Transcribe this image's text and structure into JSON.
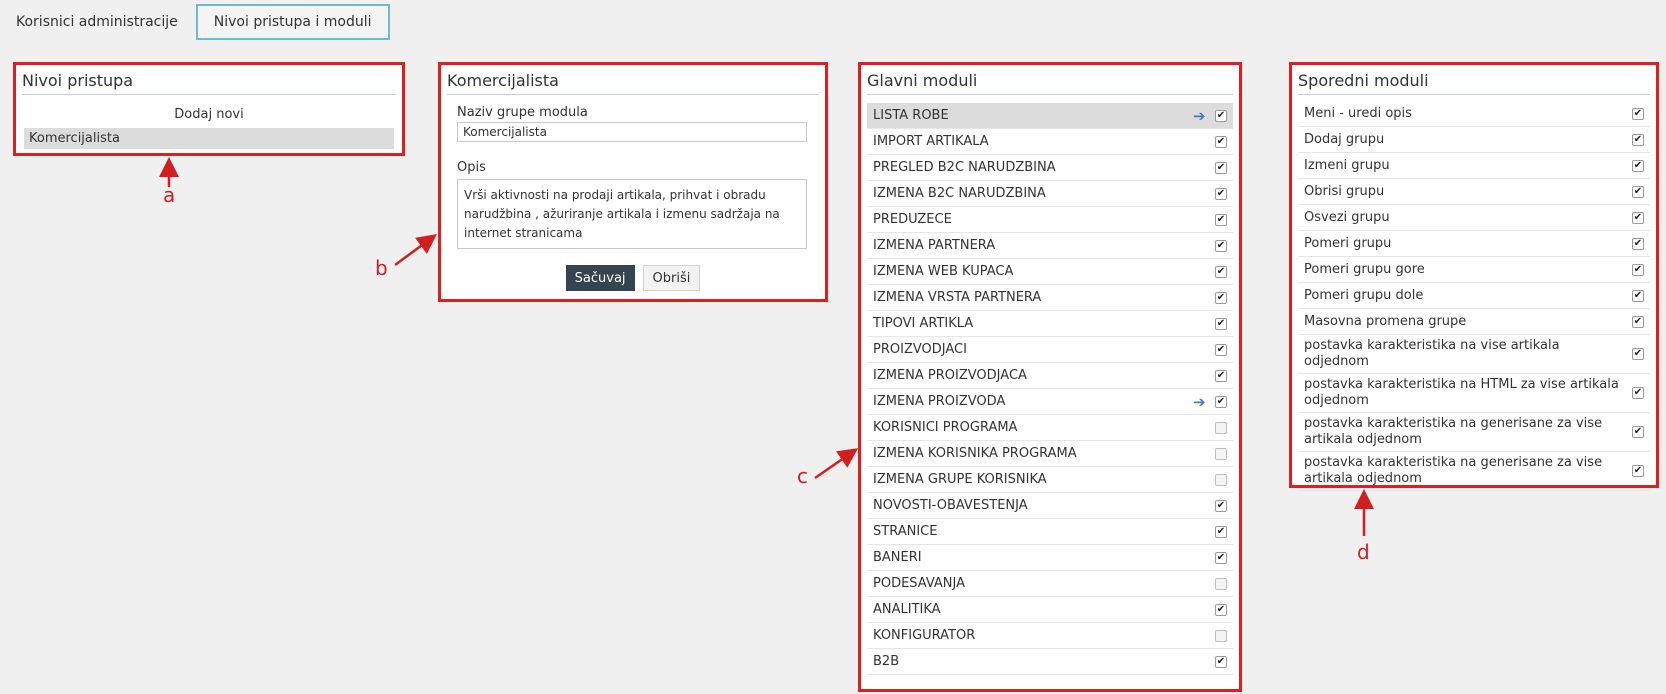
{
  "tabs": [
    {
      "label": "Korisnici administracije",
      "active": false
    },
    {
      "label": "Nivoi pristupa i moduli",
      "active": true
    }
  ],
  "access_levels": {
    "title": "Nivoi pristupa",
    "add_new": "Dodaj novi",
    "items": [
      "Komercijalista"
    ]
  },
  "group_editor": {
    "title": "Komercijalista",
    "name_label": "Naziv grupe modula",
    "name_value": "Komercijalista",
    "description_label": "Opis",
    "description_value": "Vrši aktivnosti na prodaji artikala, prihvat i obradu narudžbina , ažuriranje artikala i izmenu sadržaja na internet stranicama",
    "save_label": "Sačuvaj",
    "delete_label": "Obriši"
  },
  "main_modules": {
    "title": "Glavni moduli",
    "items": [
      {
        "label": "LISTA ROBE",
        "checked": true,
        "arrow": true,
        "highlight": true
      },
      {
        "label": "IMPORT ARTIKALA",
        "checked": true
      },
      {
        "label": "PREGLED B2C NARUDZBINA",
        "checked": true
      },
      {
        "label": "IZMENA B2C NARUDZBINA",
        "checked": true
      },
      {
        "label": "PREDUZECE",
        "checked": true
      },
      {
        "label": "IZMENA PARTNERA",
        "checked": true
      },
      {
        "label": "IZMENA WEB KUPACA",
        "checked": true
      },
      {
        "label": "IZMENA VRSTA PARTNERA",
        "checked": true
      },
      {
        "label": "TIPOVI ARTIKLA",
        "checked": true
      },
      {
        "label": "PROIZVODJACI",
        "checked": true
      },
      {
        "label": "IZMENA PROIZVODJACA",
        "checked": true
      },
      {
        "label": "IZMENA PROIZVODA",
        "checked": true,
        "arrow": true
      },
      {
        "label": "KORISNICI PROGRAMA",
        "checked": false
      },
      {
        "label": "IZMENA KORISNIKA PROGRAMA",
        "checked": false
      },
      {
        "label": "IZMENA GRUPE KORISNIKA",
        "checked": false
      },
      {
        "label": "NOVOSTI-OBAVESTENJA",
        "checked": true
      },
      {
        "label": "STRANICE",
        "checked": true
      },
      {
        "label": "BANERI",
        "checked": true
      },
      {
        "label": "PODESAVANJA",
        "checked": false
      },
      {
        "label": "ANALITIKA",
        "checked": true
      },
      {
        "label": "KONFIGURATOR",
        "checked": false
      },
      {
        "label": "B2B",
        "checked": true
      }
    ]
  },
  "side_modules": {
    "title": "Sporedni moduli",
    "items": [
      {
        "label": "Meni - uredi opis",
        "checked": true
      },
      {
        "label": "Dodaj grupu",
        "checked": true
      },
      {
        "label": "Izmeni grupu",
        "checked": true
      },
      {
        "label": "Obrisi grupu",
        "checked": true
      },
      {
        "label": "Osvezi grupu",
        "checked": true
      },
      {
        "label": "Pomeri grupu",
        "checked": true
      },
      {
        "label": "Pomeri grupu gore",
        "checked": true
      },
      {
        "label": "Pomeri grupu dole",
        "checked": true
      },
      {
        "label": "Masovna promena grupe",
        "checked": true
      },
      {
        "label": "postavka karakteristika na vise artikala odjednom",
        "checked": true
      },
      {
        "label": "postavka karakteristika na HTML za vise artikala odjednom",
        "checked": true
      },
      {
        "label": "postavka karakteristika na generisane za vise artikala odjednom",
        "checked": true
      },
      {
        "label": "postavka karakteristika na generisane za vise artikala odjednom",
        "checked": true
      }
    ]
  },
  "annotations": {
    "a": "a",
    "b": "b",
    "c": "c",
    "d": "d",
    "color": "#d11e1e"
  },
  "colors": {
    "highlight_border": "#e01e1e",
    "active_tab_border": "#6bbcd0",
    "primary_button": "#34454f",
    "arrow": "#4f77b8"
  }
}
